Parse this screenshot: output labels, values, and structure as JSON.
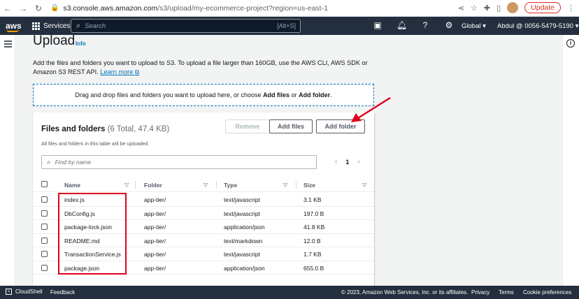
{
  "browser": {
    "url_host": "s3.console.aws.amazon.com",
    "url_path": "/s3/upload/my-ecommerce-project?region=us-east-1",
    "update_label": "Update"
  },
  "aws_nav": {
    "logo": "aws",
    "services_label": "Services",
    "search_placeholder": "Search",
    "search_shortcut": "[Alt+S]",
    "region": "Global ▾",
    "account": "Abdul @ 0056-5479-5190 ▾"
  },
  "page": {
    "title": "Upload",
    "info_label": "Info",
    "description": "Add the files and folders you want to upload to S3. To upload a file larger than 160GB, use the AWS CLI, AWS SDK or Amazon S3 REST API.",
    "learn_more": "Learn more",
    "drop_prefix": "Drag and drop files and folders you want to upload here, or choose ",
    "drop_add_files": "Add files",
    "drop_or": " or ",
    "drop_add_folder": "Add folder",
    "drop_suffix": "."
  },
  "files_panel": {
    "title": "Files and folders",
    "count": "(6 Total, 47.4 KB)",
    "subtitle": "All files and folders in this table will be uploaded.",
    "remove_label": "Remove",
    "add_files_label": "Add files",
    "add_folder_label": "Add folder",
    "filter_placeholder": "Find by name",
    "page_number": "1",
    "columns": [
      "Name",
      "Folder",
      "Type",
      "Size"
    ],
    "rows": [
      {
        "name": "index.js",
        "folder": "app-tier/",
        "type": "text/javascript",
        "size": "3.1 KB"
      },
      {
        "name": "DbConfig.js",
        "folder": "app-tier/",
        "type": "text/javascript",
        "size": "197.0 B"
      },
      {
        "name": "package-lock.json",
        "folder": "app-tier/",
        "type": "application/json",
        "size": "41.8 KB"
      },
      {
        "name": "README.md",
        "folder": "app-tier/",
        "type": "text/markdown",
        "size": "12.0 B"
      },
      {
        "name": "TransactionService.js",
        "folder": "app-tier/",
        "type": "text/javascript",
        "size": "1.7 KB"
      },
      {
        "name": "package.json",
        "folder": "app-tier/",
        "type": "application/json",
        "size": "655.0 B"
      }
    ]
  },
  "footer": {
    "cloudshell": "CloudShell",
    "feedback": "Feedback",
    "copyright": "© 2023, Amazon Web Services, Inc. or its affiliates.",
    "privacy": "Privacy",
    "terms": "Terms",
    "cookies": "Cookie preferences"
  },
  "annotation_color": "#e0001b"
}
